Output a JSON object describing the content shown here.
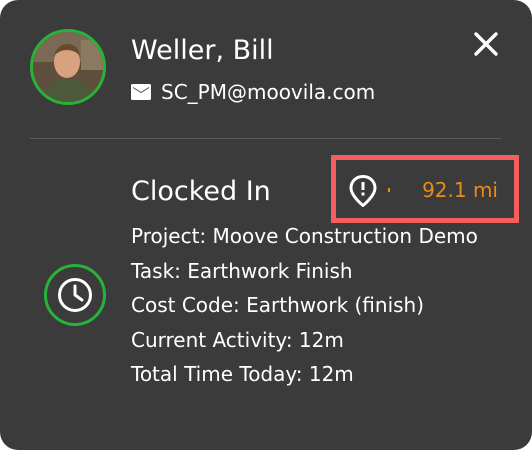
{
  "user": {
    "name": "Weller, Bill",
    "email": "SC_PM@moovila.com"
  },
  "status": {
    "title": "Clocked In",
    "distance": "92.1 mi"
  },
  "details": {
    "project": "Project: Moove Construction Demo",
    "task": "Task: Earthwork Finish",
    "cost_code": "Cost Code: Earthwork (finish)",
    "current_activity": "Current Activity: 12m",
    "total_time_today": "Total Time Today: 12m"
  },
  "colors": {
    "card_background": "#3b3b3b",
    "accent_green": "#27b23a",
    "distance_orange": "#e88c1a",
    "highlight_red": "#f25f5c"
  },
  "icons": {
    "email": "mail-icon",
    "close": "close-icon",
    "distance": "location-alert-icon",
    "status": "clock-icon"
  }
}
